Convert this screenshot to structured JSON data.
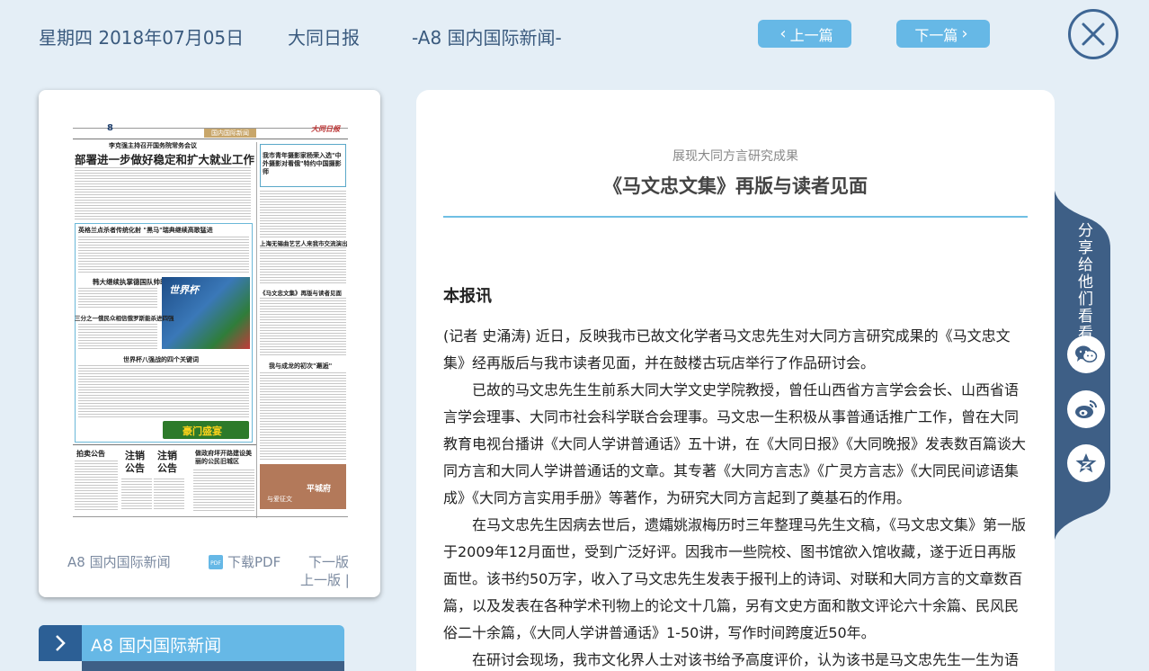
{
  "header": {
    "date": "星期四 2018年07月05日",
    "paper_name": "大同日报",
    "edition": "-A8 国内国际新闻-",
    "prev_label": "上一篇",
    "next_label": "下一篇"
  },
  "thumbnail": {
    "paper": {
      "page_no": "8",
      "section_tag": "国内国际新闻",
      "masthead": "大同日报",
      "kicker": "李克强主持召开国务院常务会议",
      "headline": "部署进一步做好稳定和扩大就业工作",
      "side_headline": "我市青年摄影家杨荣入选\"中外摄影对看俄\"特约中国摄影师",
      "h2": "英格兰点杀者传统化射 \"黑马\"瑞典继续高歌猛进",
      "h3": "韩大继续执掌德国队帅印",
      "h4": "三分之一俄民众相信俄罗斯能杀进四强",
      "h5": "世界杯八强战的四个关键词",
      "side_h2": "上海无锡曲艺艺人来我市交流演出",
      "side_h3": "《马文忠文集》再版与读者见面",
      "side_h4": "我与成龙的初次\"邂逅\"",
      "wc_text": "世界杯",
      "banner_text": "豪门盛宴",
      "notice1": "拍卖公告",
      "notice2": "注销公告",
      "notice3": "注销公告",
      "slogan": "做政府坪开路建设美丽的公民旧城区",
      "ad_text": "平城府",
      "ad_sub": "与爱征文"
    },
    "edition_link": "A8 国内国际新闻",
    "download_pdf": "下载PDF",
    "next_edition": "下一版",
    "prev_edition": "上一版 |"
  },
  "section_banner": {
    "label": "A8  国内国际新闻"
  },
  "article": {
    "subtitle": "展现大同方言研究成果",
    "title": "《马文忠文集》再版与读者见面",
    "source": "本报讯",
    "paragraphs": [
      "(记者 史涌涛) 近日，反映我市已故文化学者马文忠先生对大同方言研究成果的《马文忠文集》经再版后与我市读者见面，并在鼓楼古玩店举行了作品研讨会。",
      "已故的马文忠先生生前系大同大学文史学院教授，曾任山西省方言学会会长、山西省语言学会理事、大同市社会科学联合会理事。马文忠一生积极从事普通话推广工作，曾在大同教育电视台播讲《大同人学讲普通话》五十讲，在《大同日报》《大同晚报》发表数百篇谈大同方言和大同人学讲普通话的文章。其专著《大同方言志》《广灵方言志》《大同民间谚语集成》《大同方言实用手册》等著作，为研究大同方言起到了奠基石的作用。",
      "在马文忠先生因病去世后，遗孀姚淑梅历时三年整理马先生文稿，《马文忠文集》第一版于2009年12月面世，受到广泛好评。因我市一些院校、图书馆欲入馆收藏，遂于近日再版面世。该书约50万字，收入了马文忠先生发表于报刊上的诗词、对联和大同方言的文章数百篇，以及发表在各种学术刊物上的论文十几篇，另有文史方面和散文评论六十余篇、民风民俗二十余篇，《大同人学讲普通话》1-50讲，写作时间跨度近50年。",
      "在研讨会现场，我市文化界人士对该书给予高度评价，认为该书是马文忠先生一生为语"
    ]
  },
  "share": {
    "label": "分享给他们看看",
    "icons": [
      "wechat-icon",
      "weibo-icon",
      "qzone-icon"
    ]
  },
  "colors": {
    "background": "#e4eef6",
    "accent": "#66b8e6",
    "dark_blue": "#2c5f95",
    "text_blue": "#3a5a7e"
  }
}
